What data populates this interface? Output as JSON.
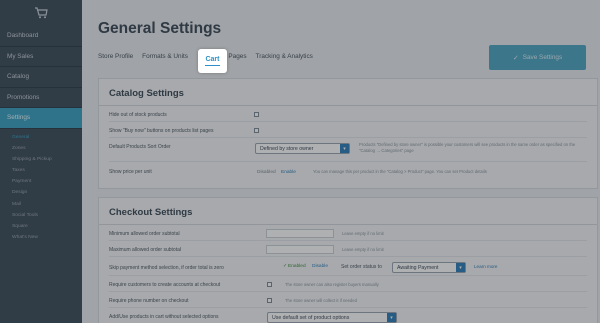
{
  "sidebar": {
    "items": [
      {
        "label": "Dashboard"
      },
      {
        "label": "My Sales"
      },
      {
        "label": "Catalog"
      },
      {
        "label": "Promotions"
      },
      {
        "label": "Settings"
      }
    ],
    "subitems": [
      {
        "label": "General"
      },
      {
        "label": "Zones"
      },
      {
        "label": "Shipping & Pickup"
      },
      {
        "label": "Taxes"
      },
      {
        "label": "Payment"
      },
      {
        "label": "Design"
      },
      {
        "label": "Mail"
      },
      {
        "label": "Social Tools"
      },
      {
        "label": "Square"
      },
      {
        "label": "What's New"
      }
    ]
  },
  "header": {
    "title": "General Settings",
    "save_label": "Save Settings"
  },
  "tabs": {
    "store_profile": "Store Profile",
    "formats_units": "Formats & Units",
    "cart": "Cart",
    "legal_pages": "Legal Pages",
    "tracking": "Tracking & Analytics"
  },
  "catalog": {
    "title": "Catalog Settings",
    "hide_out_of_stock": "Hide out of stock products",
    "show_buy_now": "Show \"Buy now\" buttons on products list pages",
    "default_sort_label": "Default Products Sort Order",
    "default_sort_value": "Defined by store owner",
    "default_sort_hint": "Products \"Defined by store owner\" is possible your customers will see products in the same order as specified on the \"Catalog → Categories\" page",
    "show_price_label": "Show price per unit",
    "price_disabled": "Disabled",
    "price_enable": "Enable",
    "price_hint": "You can manage this per product in the \"Catalog > Product\" page. You can set Product details"
  },
  "checkout": {
    "title": "Checkout Settings",
    "min_order_label": "Minimum allowed order subtotal",
    "min_order_hint": "Leave empty if no limit",
    "max_order_label": "Maximum allowed order subtotal",
    "max_order_hint": "Leave empty if no limit",
    "skip_payment_label": "Skip payment method selection, if order total is zero",
    "skip_enabled": "Enabled",
    "skip_disable": "Disable",
    "set_status_label": "Set order status to",
    "status_value": "Awaiting Payment",
    "learn_more": "Learn more",
    "require_accounts_label": "Require customers to create accounts at checkout",
    "require_accounts_hint": "The store owner can also register buyers manually",
    "require_phone_label": "Require phone number on checkout",
    "require_phone_hint": "The store owner will collect it if needed",
    "add_products_label": "Add/Use products in cart without selected options",
    "add_products_value": "Use default set of product options"
  }
}
